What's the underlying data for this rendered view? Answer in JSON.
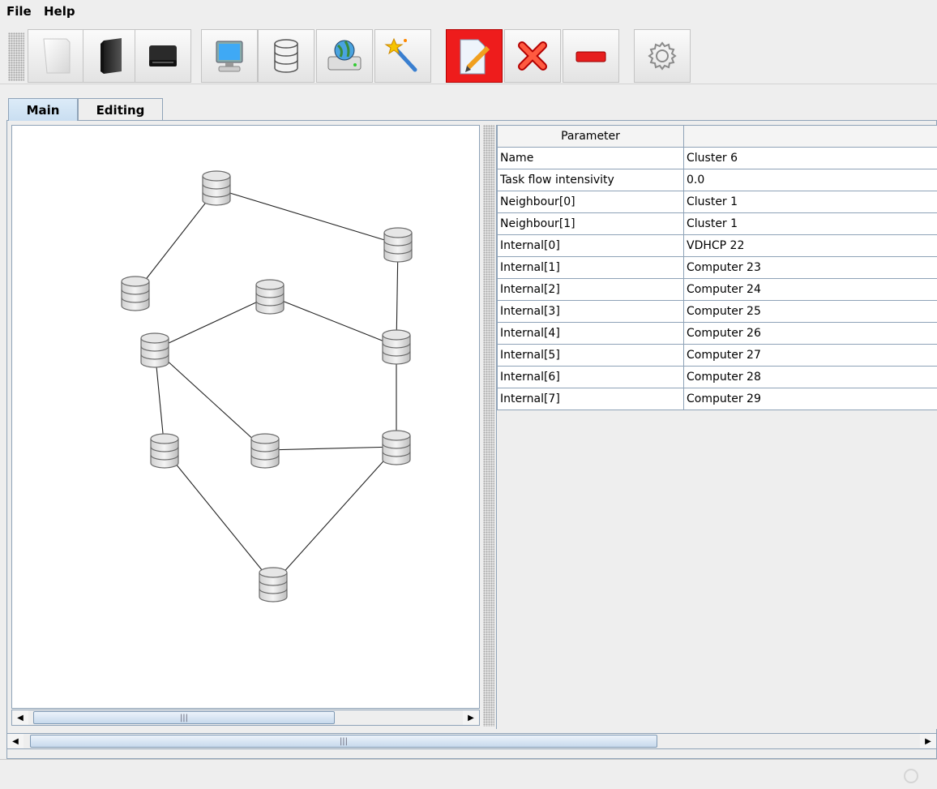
{
  "menu": {
    "items": [
      "File",
      "Help"
    ]
  },
  "toolbar": {
    "buttons": [
      {
        "icon": "new-document-icon"
      },
      {
        "icon": "open-file-icon"
      },
      {
        "icon": "save-icon"
      },
      {
        "icon": "computer-icon"
      },
      {
        "icon": "database-icon"
      },
      {
        "icon": "network-drive-icon"
      },
      {
        "icon": "magic-wand-icon"
      },
      {
        "icon": "edit-document-icon",
        "active": true
      },
      {
        "icon": "delete-icon"
      },
      {
        "icon": "remove-icon"
      },
      {
        "icon": "settings-icon"
      }
    ],
    "active_color": "#ee1c1c"
  },
  "tabs": [
    {
      "label": "Main"
    },
    {
      "label": "Editing"
    }
  ],
  "graph": {
    "nodes": [
      "database-node",
      "database-node",
      "database-node",
      "database-node",
      "database-node",
      "database-node",
      "database-node",
      "database-node",
      "database-node",
      "database-node"
    ]
  },
  "table": {
    "headers": [
      "Parameter",
      ""
    ],
    "rows": [
      [
        "Name",
        "Cluster 6"
      ],
      [
        "Task flow intensivity",
        "0.0"
      ],
      [
        "Neighbour[0]",
        "Cluster 1"
      ],
      [
        "Neighbour[1]",
        "Cluster 1"
      ],
      [
        "Internal[0]",
        "VDHCP 22"
      ],
      [
        "Internal[1]",
        "Computer 23"
      ],
      [
        "Internal[2]",
        "Computer 24"
      ],
      [
        "Internal[3]",
        "Computer 25"
      ],
      [
        "Internal[4]",
        "Computer 26"
      ],
      [
        "Internal[5]",
        "Computer 27"
      ],
      [
        "Internal[6]",
        "Computer 28"
      ],
      [
        "Internal[7]",
        "Computer 29"
      ]
    ]
  },
  "scrollbars": {
    "thumb_grip": "|||"
  }
}
